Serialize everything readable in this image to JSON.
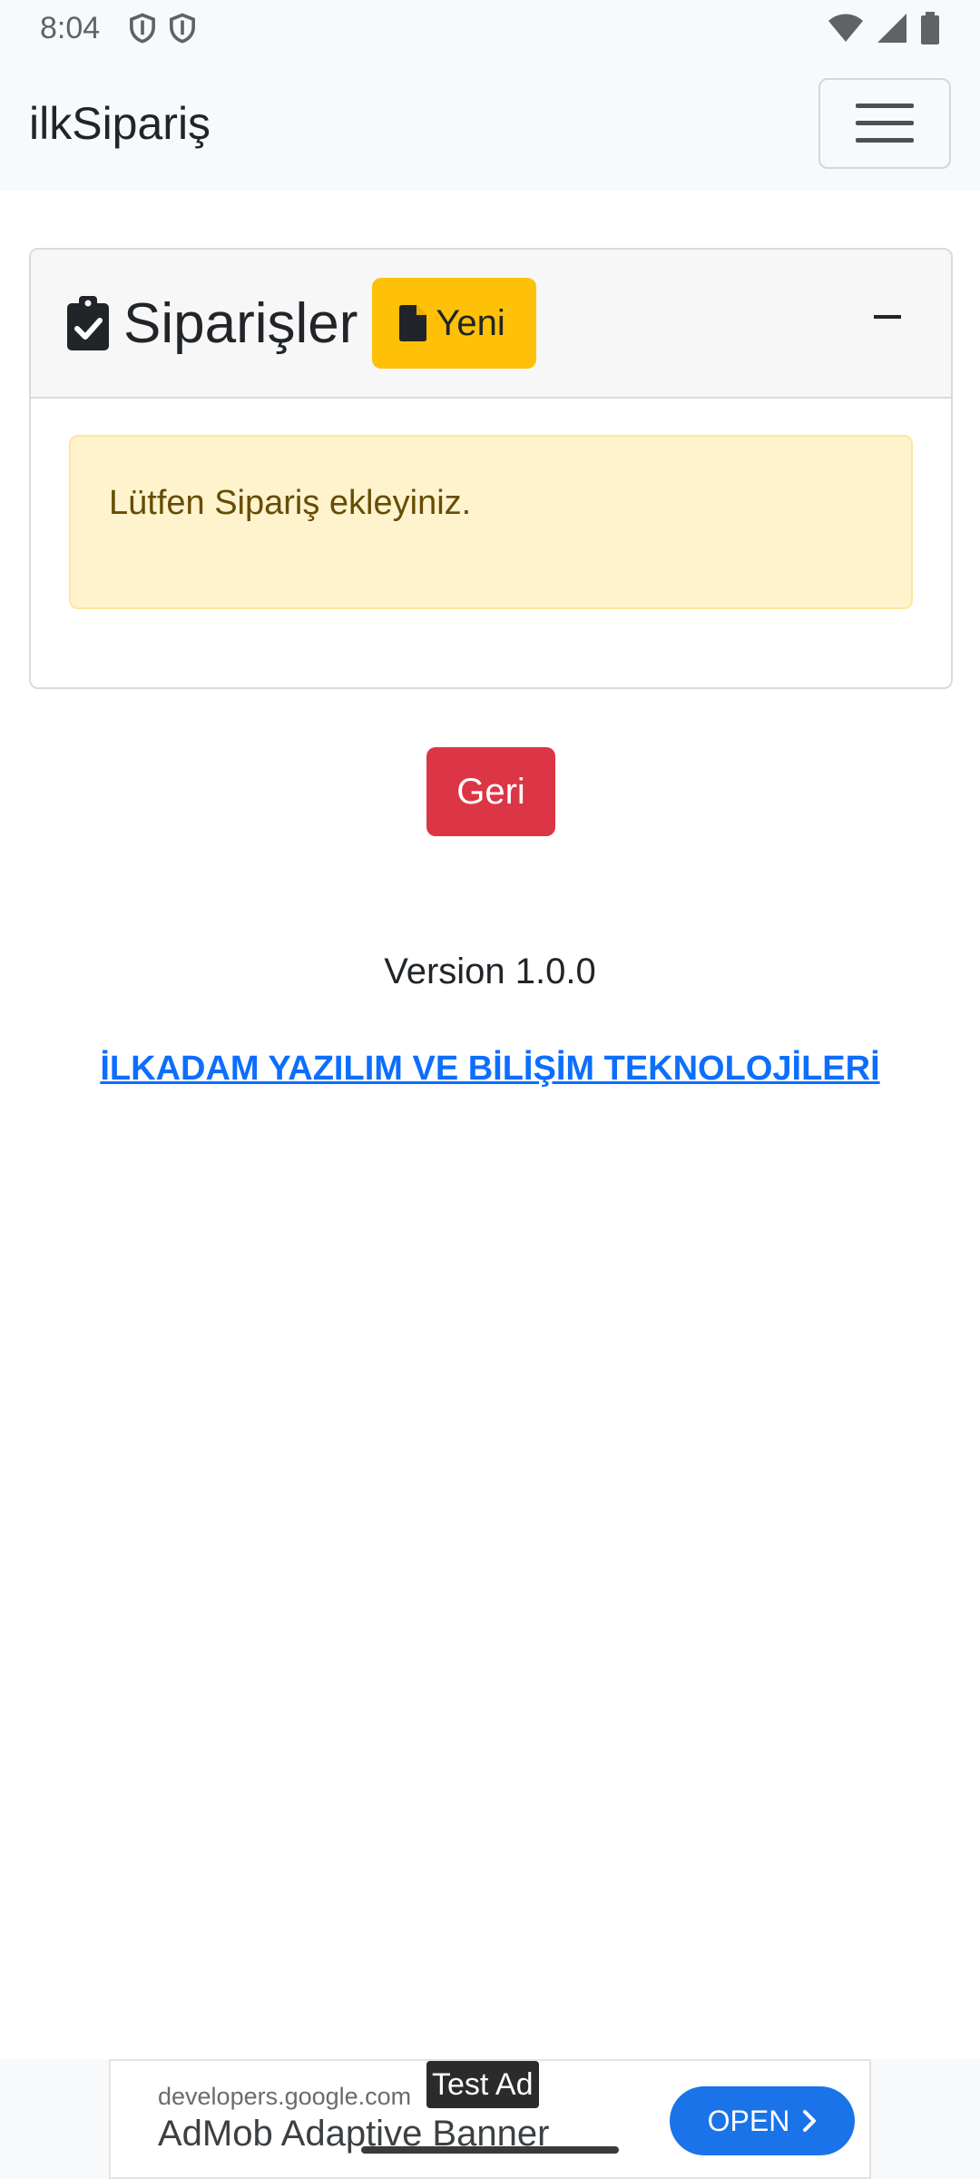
{
  "status_bar": {
    "time": "8:04",
    "left_icons": [
      "shield-icon",
      "shield-icon"
    ],
    "right_icons": [
      "wifi-icon",
      "signal-icon",
      "battery-icon"
    ]
  },
  "navbar": {
    "brand": "ilkSipariş",
    "menu_icon": "hamburger-menu-icon"
  },
  "card": {
    "title": "Siparişler",
    "title_icon": "clipboard-check-icon",
    "new_button": {
      "label": "Yeni",
      "icon": "file-icon",
      "color": "#ffc107"
    },
    "collapse_icon": "minus-icon",
    "alert_text": "Lütfen Sipariş ekleyiniz."
  },
  "back_button": {
    "label": "Geri",
    "color": "#dc3545"
  },
  "footer": {
    "version": "Version 1.0.0",
    "company_link": "İLKADAM YAZILIM VE BİLİŞİM TEKNOLOJİLERİ"
  },
  "ad": {
    "domain": "developers.google.com",
    "title": "AdMob Adaptive Banner",
    "tag": "Test Ad",
    "open_label": "OPEN"
  },
  "colors": {
    "accent": "#0d6efd",
    "alert_bg": "#fff3cd",
    "alert_text": "#664d03",
    "navbar_bg": "#f8f9fa"
  }
}
